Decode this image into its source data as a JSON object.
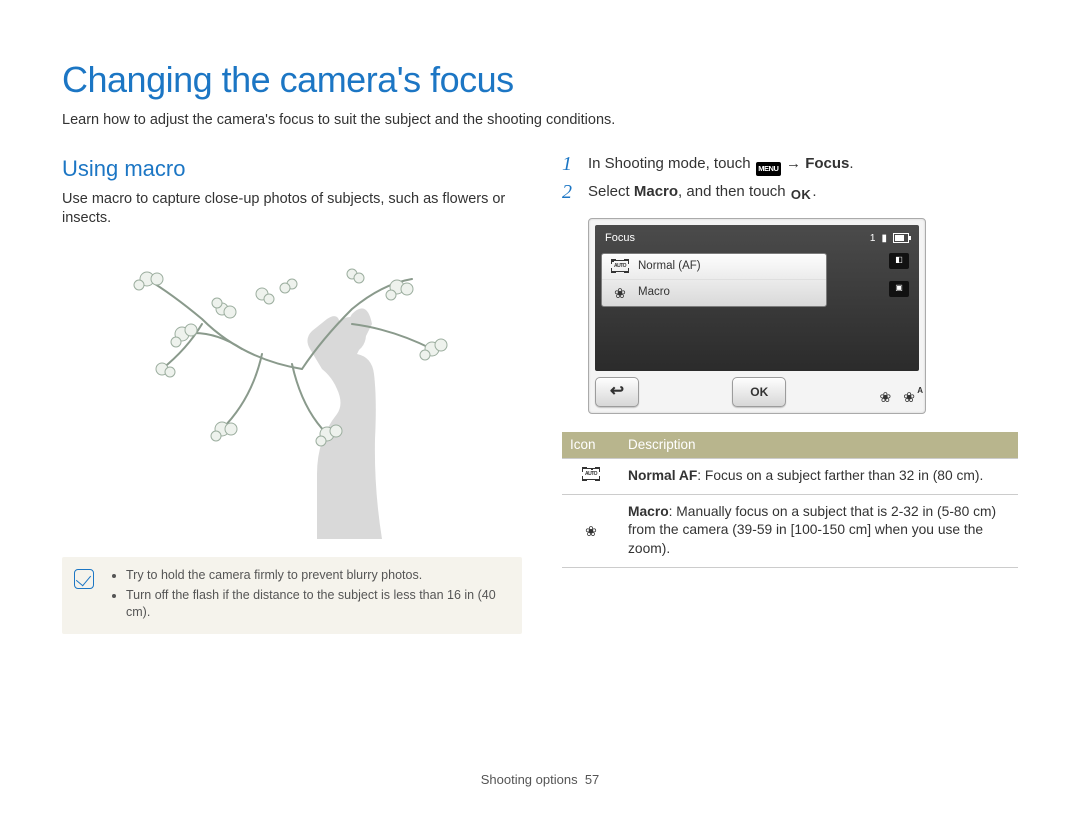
{
  "page": {
    "title": "Changing the camera's focus",
    "intro": "Learn how to adjust the camera's focus to suit the subject and the shooting conditions.",
    "footer_section": "Shooting options",
    "footer_page": "57"
  },
  "left": {
    "subhead": "Using macro",
    "para": "Use macro to capture close-up photos of subjects, such as flowers or insects.",
    "tips": [
      "Try to hold the camera firmly to prevent blurry photos.",
      "Turn off the flash if the distance to the subject is less than 16 in (40 cm)."
    ]
  },
  "steps": {
    "s1_a": "In Shooting mode, touch ",
    "s1_menu": "MENU",
    "s1_b": " → ",
    "s1_bold": "Focus",
    "s1_c": ".",
    "s2_a": "Select ",
    "s2_bold": "Macro",
    "s2_b": ", and then touch ",
    "s2_ok": "OK",
    "s2_c": "."
  },
  "screen": {
    "header": "Focus",
    "status_count": "1",
    "list": {
      "normal_af_label": "Normal (AF)",
      "macro_label": "Macro"
    },
    "btn_back": "↩",
    "btn_ok": "OK"
  },
  "table": {
    "hdr_icon": "Icon",
    "hdr_desc": "Description",
    "rows": [
      {
        "icon": "normal-af",
        "term": "Normal AF",
        "desc": ": Focus on a subject farther than 32 in (80 cm)."
      },
      {
        "icon": "macro",
        "term": "Macro",
        "desc": ": Manually focus on a subject that is 2-32 in (5-80 cm) from the camera (39-59 in [100-150 cm] when you use the zoom)."
      }
    ]
  }
}
